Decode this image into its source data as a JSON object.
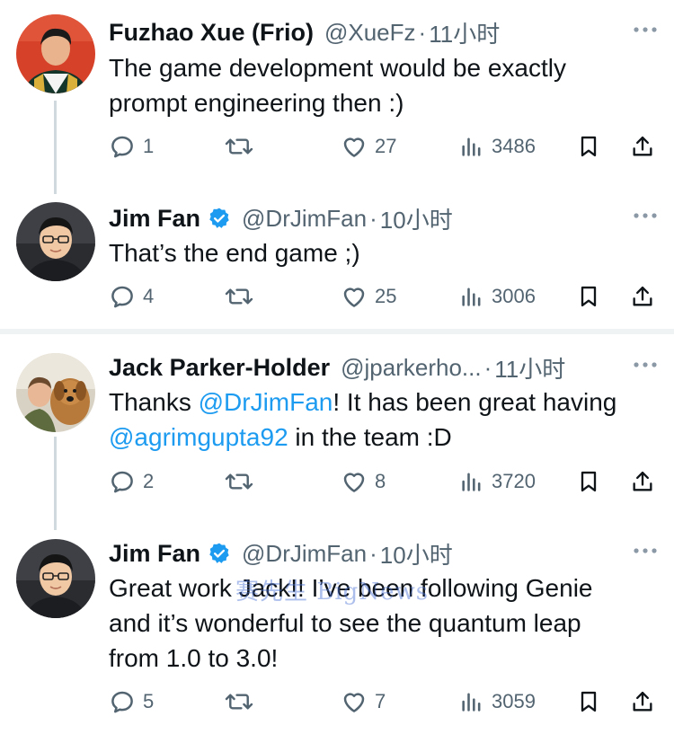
{
  "tweets": [
    {
      "name": "Fuzhao Xue (Frio)",
      "handle": "@XueFz",
      "time": "11小时",
      "verified": false,
      "text_lines": [
        "The game development would be exactly",
        "prompt engineering then :)"
      ],
      "replies": "1",
      "retweets": "",
      "likes": "27",
      "views": "3486"
    },
    {
      "name": "Jim Fan",
      "handle": "@DrJimFan",
      "time": "10小时",
      "verified": true,
      "text_lines": [
        "That’s the end game ;)"
      ],
      "replies": "4",
      "retweets": "",
      "likes": "25",
      "views": "3006"
    },
    {
      "name": "Jack Parker-Holder",
      "handle": "@jparkerho...",
      "time": "11小时",
      "verified": false,
      "text_parts": {
        "l1a": "Thanks ",
        "l1m": "@DrJimFan",
        "l1b": "! It has been great having",
        "l2m": "@agrimgupta92",
        "l2b": " in the team :D"
      },
      "replies": "2",
      "retweets": "",
      "likes": "8",
      "views": "3720"
    },
    {
      "name": "Jim Fan",
      "handle": "@DrJimFan",
      "time": "10小时",
      "verified": true,
      "text_lines": [
        "Great work Jack!! I’ve been following Genie",
        "and it’s wonderful to see the quantum leap",
        "from 1.0 to 3.0!"
      ],
      "replies": "5",
      "retweets": "",
      "likes": "7",
      "views": "3059"
    }
  ],
  "separator": "·",
  "watermark": "赛先生 BigNews",
  "colors": {
    "text": "#0f1419",
    "secondary": "#536471",
    "link": "#1d9bf0",
    "verified": "#1d9bf0",
    "line": "#cfd9de"
  },
  "icons": [
    "reply-icon",
    "retweet-icon",
    "like-icon",
    "views-icon",
    "bookmark-icon",
    "share-icon",
    "more-icon",
    "verified-icon"
  ]
}
